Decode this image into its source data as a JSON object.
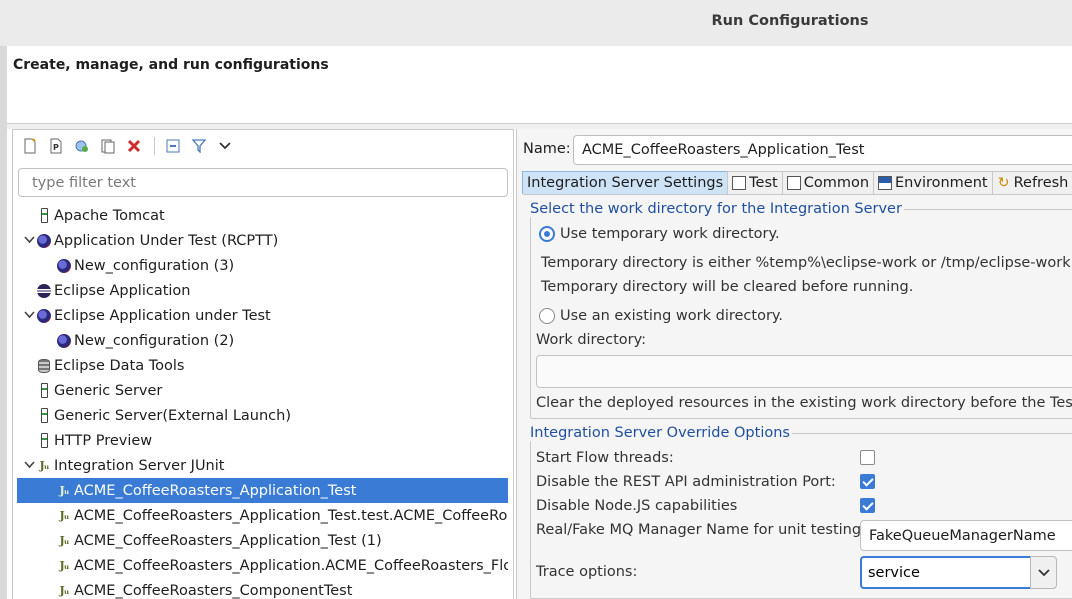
{
  "window": {
    "title": "Run Configurations"
  },
  "header": {
    "text": "Create, manage, and run configurations"
  },
  "toolbar": {
    "icons": [
      "new-config-icon",
      "new-prototype-icon",
      "duplicate-icon",
      "export-icon",
      "delete-icon",
      "collapse-all-icon",
      "filter-icon",
      "chevron-down-icon"
    ]
  },
  "filter": {
    "placeholder": "type filter text",
    "value": ""
  },
  "tree": {
    "items": [
      {
        "label": "Apache Tomcat",
        "icon": "server-icon",
        "level": 0,
        "twisty": ""
      },
      {
        "label": "Application Under Test (RCPTT)",
        "icon": "rcptt-icon",
        "level": 0,
        "twisty": "expanded"
      },
      {
        "label": "New_configuration (3)",
        "icon": "rcptt-icon",
        "level": 1,
        "twisty": ""
      },
      {
        "label": "Eclipse Application",
        "icon": "eclipse-icon",
        "level": 0,
        "twisty": ""
      },
      {
        "label": "Eclipse Application under Test",
        "icon": "rcptt-icon",
        "level": 0,
        "twisty": "expanded"
      },
      {
        "label": "New_configuration (2)",
        "icon": "rcptt-icon",
        "level": 1,
        "twisty": ""
      },
      {
        "label": "Eclipse Data Tools",
        "icon": "database-icon",
        "level": 0,
        "twisty": ""
      },
      {
        "label": "Generic Server",
        "icon": "server-icon",
        "level": 0,
        "twisty": ""
      },
      {
        "label": "Generic Server(External Launch)",
        "icon": "server-icon",
        "level": 0,
        "twisty": ""
      },
      {
        "label": "HTTP Preview",
        "icon": "server-icon",
        "level": 0,
        "twisty": ""
      },
      {
        "label": "Integration Server JUnit",
        "icon": "junit-icon",
        "level": 0,
        "twisty": "expanded"
      },
      {
        "label": "ACME_CoffeeRoasters_Application_Test",
        "icon": "junit-icon",
        "level": 1,
        "twisty": "",
        "selected": true
      },
      {
        "label": "ACME_CoffeeRoasters_Application_Test.test.ACME_CoffeeRoasters",
        "icon": "junit-icon",
        "level": 1,
        "twisty": ""
      },
      {
        "label": "ACME_CoffeeRoasters_Application_Test (1)",
        "icon": "junit-icon",
        "level": 1,
        "twisty": ""
      },
      {
        "label": "ACME_CoffeeRoasters_Application.ACME_CoffeeRoasters_Flow",
        "icon": "junit-icon",
        "level": 1,
        "twisty": ""
      },
      {
        "label": "ACME_CoffeeRoasters_ComponentTest",
        "icon": "junit-icon",
        "level": 1,
        "twisty": ""
      }
    ]
  },
  "config": {
    "name_label": "Name:",
    "name_value": "ACME_CoffeeRoasters_Application_Test",
    "tabs": [
      {
        "label": "Integration Server Settings",
        "icon": "",
        "active": true
      },
      {
        "label": "Test",
        "icon": "test-icon"
      },
      {
        "label": "Common",
        "icon": "common-icon"
      },
      {
        "label": "Environment",
        "icon": "environment-icon"
      },
      {
        "label": "Refresh",
        "icon": "refresh-icon"
      }
    ],
    "workdir": {
      "group_title": "Select the work directory for the Integration Server",
      "temp_label": "Use temporary work directory.",
      "temp_selected": true,
      "info_line1": "Temporary directory is either %temp%\\eclipse-work or /tmp/eclipse-work",
      "info_line2": "Temporary directory will be cleared before running.",
      "existing_label": "Use an existing work directory.",
      "workdir_label": "Work directory:",
      "workdir_value": "",
      "clear_label": "Clear the deployed resources in the existing work directory before the Test"
    },
    "override": {
      "group_title": "Integration Server Override Options",
      "start_flow_label": "Start Flow threads:",
      "start_flow_checked": false,
      "disable_rest_label": "Disable the REST API administration Port:",
      "disable_rest_checked": true,
      "disable_node_label": "Disable Node.JS capabilities",
      "disable_node_checked": true,
      "mq_label": "Real/Fake MQ Manager Name for unit testing:",
      "mq_value": "FakeQueueManagerName",
      "trace_label": "Trace options:",
      "trace_value": "service"
    }
  }
}
